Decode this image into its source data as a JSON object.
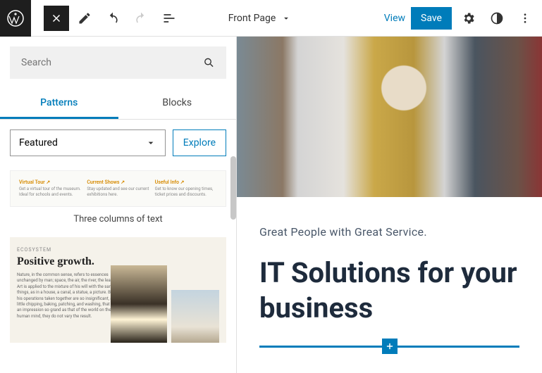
{
  "toolbar": {
    "page_title": "Front Page",
    "view_label": "View",
    "save_label": "Save"
  },
  "sidebar": {
    "search_placeholder": "Search",
    "tabs": {
      "patterns": "Patterns",
      "blocks": "Blocks"
    },
    "dropdown_value": "Featured",
    "explore_label": "Explore",
    "patterns": [
      {
        "label": "Three columns of text",
        "cols": [
          {
            "h": "Virtual Tour ↗",
            "t": "Get a virtual tour of the museum. Ideal for schools and events."
          },
          {
            "h": "Current Shows ↗",
            "t": "Stay updated and see our current exhibitions here."
          },
          {
            "h": "Useful Info ↗",
            "t": "Get to know our opening times, ticket prices and discounts."
          }
        ]
      },
      {
        "eyebrow": "ECOSYSTEM",
        "heading": "Positive growth.",
        "body": "Nature, in the common sense, refers to essences unchanged by man; space, the air, the river, the leaf. Art is applied to the mixture of his will with the same things, as in a house, a canal, a statue, a picture. But his operations taken together are so insignificant, a little chipping, baking, patching, and washing, that in an impression so grand as that of the world on the human mind, they do not vary the result."
      }
    ]
  },
  "canvas": {
    "subtitle": "Great People with Great Service.",
    "headline": "IT Solutions for your business"
  }
}
